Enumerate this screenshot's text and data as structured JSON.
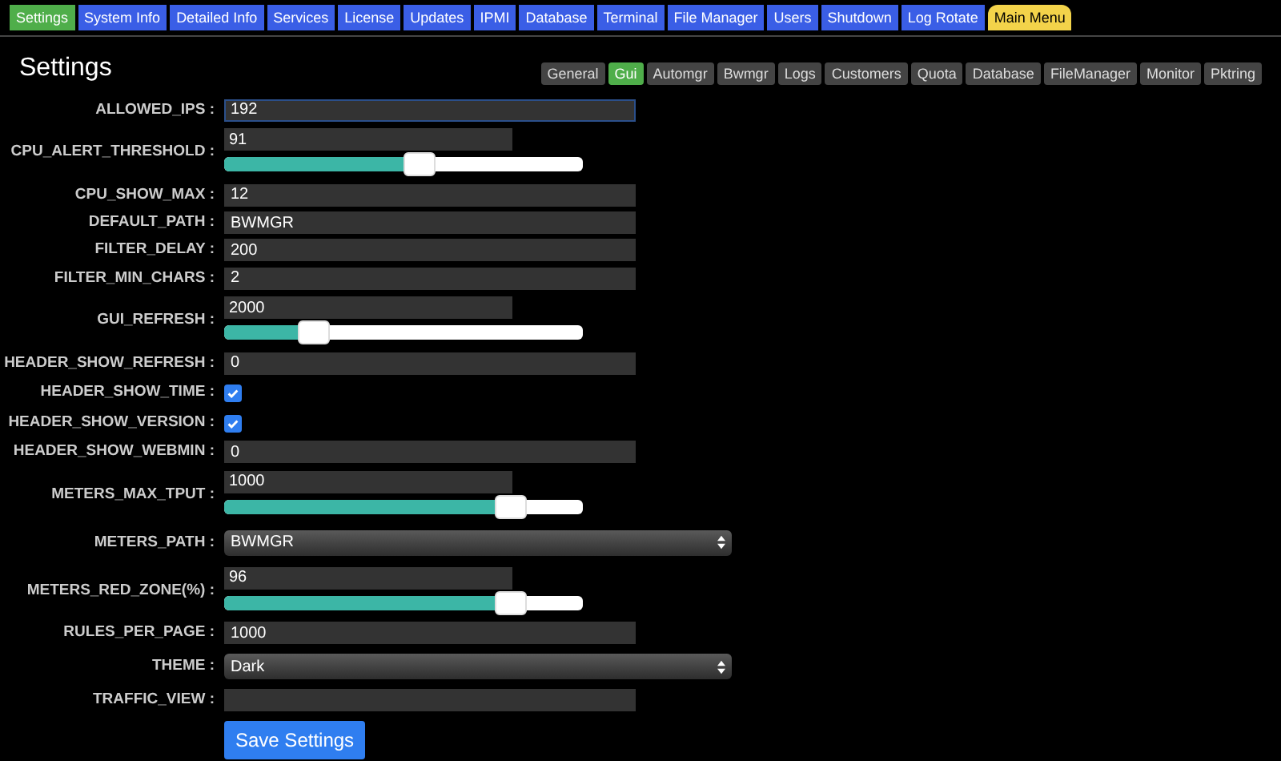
{
  "nav": [
    {
      "label": "Settings",
      "kind": "tab",
      "selected": true
    },
    {
      "label": "System Info",
      "kind": "tab",
      "selected": false
    },
    {
      "label": "Detailed Info",
      "kind": "tab",
      "selected": false
    },
    {
      "label": "Services",
      "kind": "tab",
      "selected": false
    },
    {
      "label": "License",
      "kind": "tab",
      "selected": false
    },
    {
      "label": "Updates",
      "kind": "tab",
      "selected": false
    },
    {
      "label": "IPMI",
      "kind": "tab",
      "selected": false
    },
    {
      "label": "Database",
      "kind": "tab",
      "selected": false
    },
    {
      "label": "Terminal",
      "kind": "tab",
      "selected": false
    },
    {
      "label": "File Manager",
      "kind": "tab",
      "selected": false
    },
    {
      "label": "Users",
      "kind": "tab",
      "selected": false
    },
    {
      "label": "Shutdown",
      "kind": "tab",
      "selected": false
    },
    {
      "label": "Log Rotate",
      "kind": "tab",
      "selected": false
    },
    {
      "label": "Main Menu",
      "kind": "menu",
      "selected": false
    }
  ],
  "title": "Settings",
  "subtabs": [
    {
      "label": "General",
      "selected": false
    },
    {
      "label": "Gui",
      "selected": true
    },
    {
      "label": "Automgr",
      "selected": false
    },
    {
      "label": "Bwmgr",
      "selected": false
    },
    {
      "label": "Logs",
      "selected": false
    },
    {
      "label": "Customers",
      "selected": false
    },
    {
      "label": "Quota",
      "selected": false
    },
    {
      "label": "Database",
      "selected": false
    },
    {
      "label": "FileManager",
      "selected": false
    },
    {
      "label": "Monitor",
      "selected": false
    },
    {
      "label": "Pktring",
      "selected": false
    }
  ],
  "fields": [
    {
      "label": "ALLOWED_IPS :",
      "kind": "text",
      "value": "192",
      "focused": true
    },
    {
      "label": "CPU_ALERT_THRESHOLD :",
      "kind": "slider",
      "value": "91",
      "level": 0.545
    },
    {
      "label": "CPU_SHOW_MAX :",
      "kind": "text",
      "value": "12",
      "focused": false
    },
    {
      "label": "DEFAULT_PATH :",
      "kind": "text",
      "value": "BWMGR",
      "focused": false
    },
    {
      "label": "FILTER_DELAY :",
      "kind": "text",
      "value": "200",
      "focused": false
    },
    {
      "label": "FILTER_MIN_CHARS :",
      "kind": "text",
      "value": "2",
      "focused": false
    },
    {
      "label": "GUI_REFRESH :",
      "kind": "slider",
      "value": "2000",
      "level": 0.25
    },
    {
      "label": "HEADER_SHOW_REFRESH :",
      "kind": "text",
      "value": "0",
      "focused": false
    },
    {
      "label": "HEADER_SHOW_TIME :",
      "kind": "checkbox",
      "checked": true
    },
    {
      "label": "HEADER_SHOW_VERSION :",
      "kind": "checkbox",
      "checked": true
    },
    {
      "label": "HEADER_SHOW_WEBMIN :",
      "kind": "text",
      "value": "0",
      "focused": false
    },
    {
      "label": "METERS_MAX_TPUT :",
      "kind": "slider",
      "value": "1000",
      "level": 0.8
    },
    {
      "label": "METERS_PATH :",
      "kind": "select",
      "value": "BWMGR"
    },
    {
      "label": "METERS_RED_ZONE(%) :",
      "kind": "slider",
      "value": "96",
      "level": 0.8
    },
    {
      "label": "RULES_PER_PAGE :",
      "kind": "text",
      "value": "1000",
      "focused": false
    },
    {
      "label": "THEME :",
      "kind": "select",
      "value": "Dark"
    },
    {
      "label": "TRAFFIC_VIEW :",
      "kind": "text",
      "focused": false
    }
  ],
  "save_button": "Save Settings"
}
